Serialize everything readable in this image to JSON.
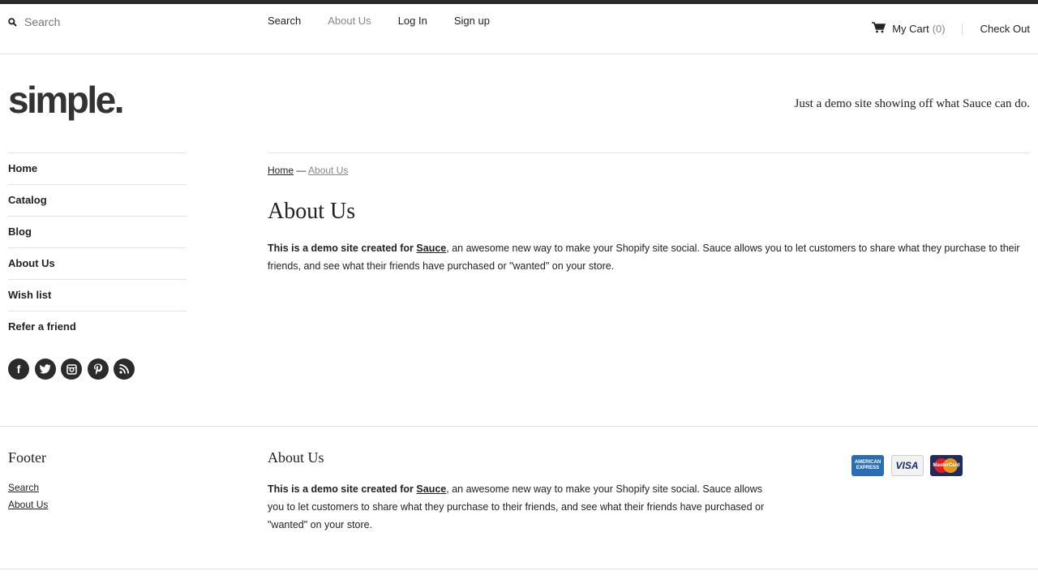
{
  "header": {
    "search_placeholder": "Search",
    "nav": [
      {
        "label": "Search"
      },
      {
        "label": "About Us",
        "active": true
      },
      {
        "label": "Log In"
      },
      {
        "label": "Sign up"
      }
    ],
    "cart_label": "My Cart",
    "cart_count": "(0)",
    "checkout_label": "Check Out",
    "icons": {
      "search": "search-icon",
      "cart": "cart-icon"
    }
  },
  "brand": {
    "logo": "simple.",
    "tagline": "Just a demo site showing off what Sauce can do."
  },
  "sidebar": {
    "items": [
      {
        "label": "Home"
      },
      {
        "label": "Catalog"
      },
      {
        "label": "Blog"
      },
      {
        "label": "About Us"
      },
      {
        "label": "Wish list"
      },
      {
        "label": "Refer a friend"
      }
    ],
    "social": [
      "facebook-icon",
      "twitter-icon",
      "instagram-icon",
      "pinterest-icon",
      "rss-icon"
    ]
  },
  "main": {
    "breadcrumb": {
      "home": "Home",
      "separator": "—",
      "current": "About Us"
    },
    "title": "About Us",
    "intro_bold": "This is a demo site created for",
    "intro_link": "Sauce",
    "intro_rest": ", an awesome new way to make your Shopify site social. Sauce allows you to let customers to share what they purchase to their friends, and see what their friends have purchased or \"wanted\" on your store."
  },
  "footer": {
    "col1_title": "Footer",
    "col1_links": [
      "Search",
      "About Us"
    ],
    "col2_title": "About Us",
    "col2_bold": "This is a demo site created for",
    "col2_link": "Sauce",
    "col2_rest": ", an awesome new way to make your Shopify site social. Sauce allows you to let customers to share what they purchase to their friends, and see what their friends have purchased or \"wanted\" on your store.",
    "cards": [
      {
        "name": "american-express",
        "label": "AMERICAN EXPRESS"
      },
      {
        "name": "visa",
        "label": "VISA"
      },
      {
        "name": "mastercard",
        "label": "MasterCard"
      }
    ]
  },
  "colors": {
    "topbar": "#2b2b2b",
    "muted": "#888888",
    "divider": "#e3e3e3"
  }
}
